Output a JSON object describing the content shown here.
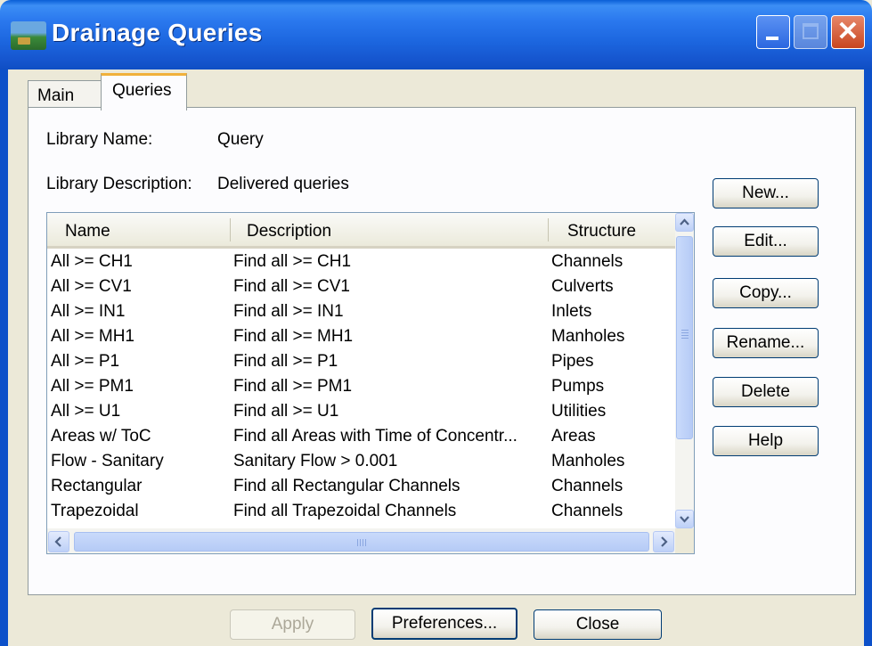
{
  "window": {
    "title": "Drainage Queries"
  },
  "tabs": [
    {
      "label": "Main"
    },
    {
      "label": "Queries"
    }
  ],
  "library": {
    "name_label": "Library Name:",
    "name_value": "Query",
    "desc_label": "Library Description:",
    "desc_value": "Delivered queries"
  },
  "list": {
    "columns": [
      "Name",
      "Description",
      "Structure"
    ],
    "rows": [
      {
        "name": "All >= CH1",
        "description": "Find all  >=  CH1",
        "structure": "Channels"
      },
      {
        "name": "All >= CV1",
        "description": "Find all  >=  CV1",
        "structure": "Culverts"
      },
      {
        "name": "All >= IN1",
        "description": "Find all  >=  IN1",
        "structure": "Inlets"
      },
      {
        "name": "All >= MH1",
        "description": "Find all  >=  MH1",
        "structure": "Manholes"
      },
      {
        "name": "All >= P1",
        "description": "Find all  >=  P1",
        "structure": "Pipes"
      },
      {
        "name": "All >= PM1",
        "description": "Find all  >=  PM1",
        "structure": "Pumps"
      },
      {
        "name": "All >= U1",
        "description": "Find all  >=  U1",
        "structure": "Utilities"
      },
      {
        "name": "Areas w/ ToC",
        "description": "Find all Areas with Time of Concentr...",
        "structure": "Areas"
      },
      {
        "name": "Flow - Sanitary",
        "description": "Sanitary Flow > 0.001",
        "structure": "Manholes"
      },
      {
        "name": "Rectangular",
        "description": "Find all Rectangular Channels",
        "structure": "Channels"
      },
      {
        "name": "Trapezoidal",
        "description": "Find all Trapezoidal Channels",
        "structure": "Channels"
      }
    ]
  },
  "side_buttons": {
    "new": "New...",
    "edit": "Edit...",
    "copy": "Copy...",
    "rename": "Rename...",
    "delete": "Delete",
    "help": "Help"
  },
  "bottom_buttons": {
    "apply": "Apply",
    "preferences": "Preferences...",
    "close": "Close"
  },
  "colors": {
    "titlebar": "#2a78ee",
    "dialog_bg": "#ece9d8",
    "tab_accent": "#f0b13b",
    "close_button": "#c8461f"
  }
}
